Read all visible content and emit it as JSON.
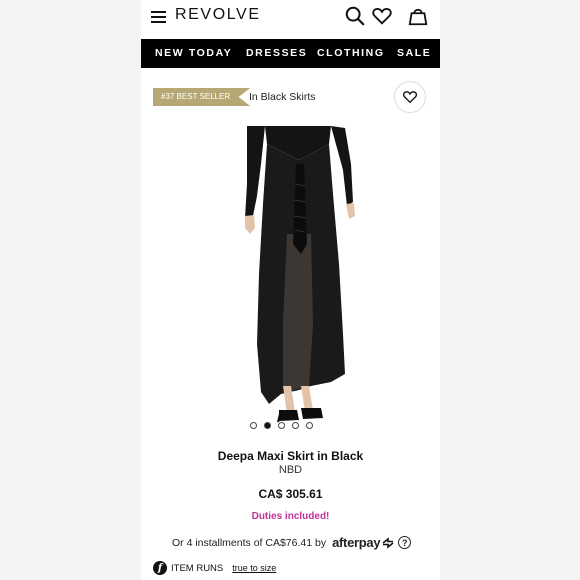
{
  "header": {
    "logo": "REVOLVE",
    "menu_icon": "hamburger-menu-icon",
    "search_icon": "search-icon",
    "wishlist_icon": "heart-icon",
    "bag_icon": "shopping-bag-icon"
  },
  "nav": {
    "items": [
      {
        "label": "NEW TODAY"
      },
      {
        "label": "DRESSES"
      },
      {
        "label": "CLOTHING"
      },
      {
        "label": "SALE"
      }
    ]
  },
  "product": {
    "badge": "#37 BEST SELLER",
    "category": "In Black Skirts",
    "title": "Deepa Maxi Skirt in Black",
    "brand": "NBD",
    "price": "CA$ 305.61",
    "duties": "Duties included!",
    "image_count": 5,
    "active_image": 2
  },
  "payment": {
    "installments_text": "Or 4 installments of CA$76.41 by",
    "provider": "afterpay",
    "help_icon": "help-icon"
  },
  "fit": {
    "label": "ITEM RUNS",
    "link": "true to size"
  },
  "colors": {
    "badge_bg": "#b6a874",
    "duties_text": "#c0349a",
    "nav_bg": "#000000"
  }
}
